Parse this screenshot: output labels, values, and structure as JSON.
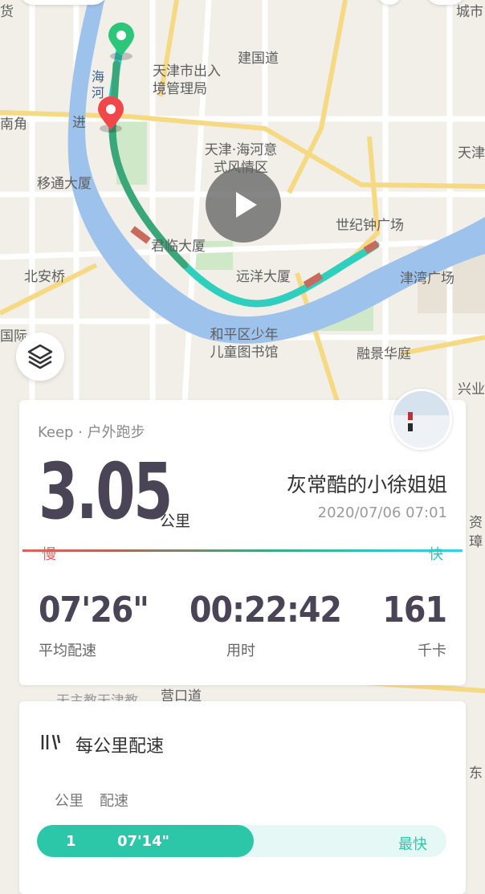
{
  "map": {
    "labels": {
      "haihe": "海河",
      "jianguodao": "建国道",
      "immigration": "天津市出入境管理局",
      "nanjiao": "南角",
      "jin": "进",
      "yidong": "移通大厦",
      "italian_area": "天津·海河意式风情区",
      "century_clock": "世纪钟广场",
      "junlin": "君临大厦",
      "yuanyang": "远洋大厦",
      "jinwan": "津湾广场",
      "beian": "北安桥",
      "library": "和平区少年儿童图书馆",
      "rongjing": "融景华庭",
      "guoji": "国际",
      "tianjin_right": "天津",
      "xingye": "兴业",
      "yingkou": "营口道",
      "church": "天主教天津教",
      "huo": "货",
      "city": "城市",
      "zi": "资",
      "zhang": "璋",
      "dong": "东"
    },
    "route_colors": {
      "fast": "#2ecfbd",
      "mid": "#3aa77a",
      "slow": "#c96b5c"
    },
    "start_pin_color": "#2cc67a",
    "end_pin_color": "#f0484a"
  },
  "controls": {
    "play_icon": "play-icon",
    "layers_icon": "layers-icon"
  },
  "summary": {
    "source": "Keep · 户外跑步",
    "distance": "3.05",
    "distance_unit": "公里",
    "user_name": "灰常酷的小徐姐姐",
    "timestamp": "2020/07/06 07:01",
    "slow_label": "慢",
    "fast_label": "快",
    "stats": {
      "avg_pace": "07'26\"",
      "avg_pace_label": "平均配速",
      "duration": "00:22:42",
      "duration_label": "用时",
      "calories": "161",
      "calories_label": "千卡"
    }
  },
  "splits": {
    "title": "每公里配速",
    "col_km": "公里",
    "col_pace": "配速",
    "rows": [
      {
        "km": "1",
        "pace": "07'14\"",
        "tag": "最快",
        "fill_fraction": 0.53
      }
    ]
  }
}
